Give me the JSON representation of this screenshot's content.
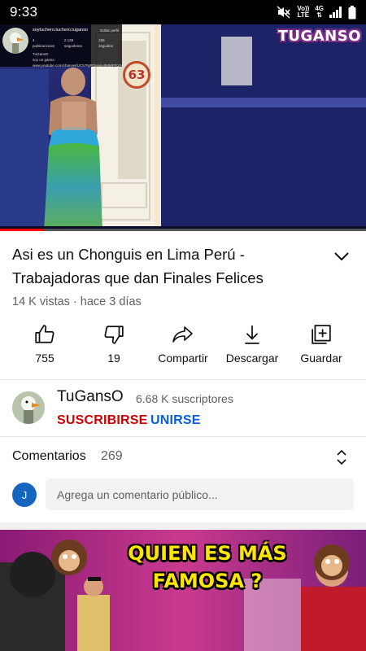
{
  "status_bar": {
    "time": "9:33",
    "volte": "Vo))",
    "lte": "LTE",
    "network": "4G"
  },
  "player": {
    "channel_badge": "TUGANSO",
    "room_number": "63",
    "progress_fraction": 0.12,
    "overlay": {
      "handle": "soytuchero.tuchero.tuganso",
      "tag": "Editar perfil",
      "stats": [
        "4 publicaciones",
        "2.139 seguidores",
        "265 seguidos"
      ],
      "bio_name": "TuGansO",
      "bio_line": "soy un ganso",
      "link": "www.youtube.com/channel/UC57NjPQxaoiuI94MFFjZAHQ"
    }
  },
  "video": {
    "title": "Asi es un Chonguis en Lima Perú - Trabajadoras que dan Finales Felices",
    "meta": "14 K vistas · hace 3 días"
  },
  "actions": {
    "like": "755",
    "dislike": "19",
    "share": "Compartir",
    "download": "Descargar",
    "save": "Guardar"
  },
  "channel": {
    "name": "TuGansO",
    "subscribers": "6.68 K suscriptores",
    "subscribe_label": "SUSCRIBIRSE",
    "join_label": "UNIRSE"
  },
  "comments": {
    "label": "Comentarios",
    "count": "269",
    "user_initial": "J",
    "placeholder": "Agrega un comentario público..."
  },
  "next_video": {
    "thumbnail_text": "QUIEN ES MÁS FAMOSA ?"
  },
  "colors": {
    "subscribe": "#cc0000",
    "join": "#065fd4",
    "progress": "#ff0000",
    "avatar_bg": "#1565c0"
  }
}
